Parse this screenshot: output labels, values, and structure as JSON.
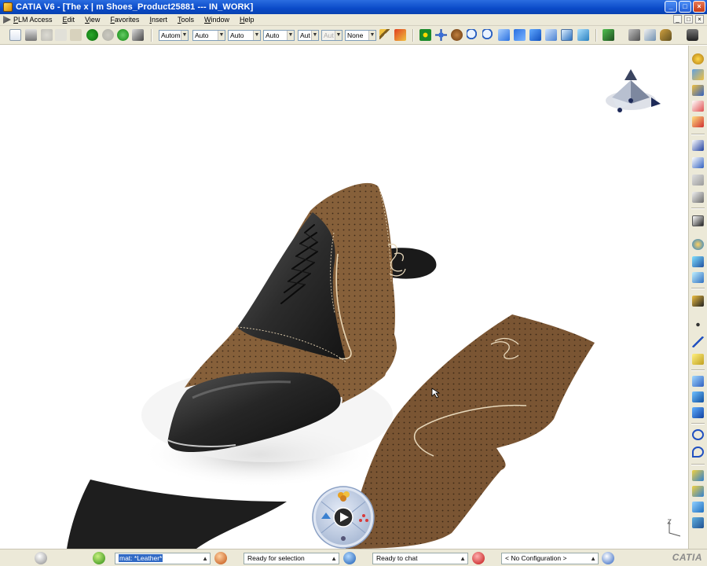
{
  "window": {
    "title": "CATIA V6 - [The x | m Shoes_Product25881 --- IN_WORK]",
    "buttons": {
      "minimize": "_",
      "maximize": "□",
      "close": "×"
    }
  },
  "menubar": {
    "items": [
      "PLM Access",
      "Edit",
      "View",
      "Favorites",
      "Insert",
      "Tools",
      "Window",
      "Help"
    ],
    "controls": [
      "_",
      "□",
      "×"
    ]
  },
  "toolbar": {
    "combos": [
      {
        "value": "Automa",
        "enabled": true
      },
      {
        "value": "Auto",
        "enabled": true
      },
      {
        "value": "Auto",
        "enabled": true
      },
      {
        "value": "Auto",
        "enabled": true
      },
      {
        "value": "Aut",
        "enabled": true
      },
      {
        "value": "Aut",
        "enabled": false
      },
      {
        "value": "None",
        "enabled": true
      }
    ],
    "icons": [
      "new-icon",
      "print-icon",
      "cut-icon",
      "copy-icon",
      "paste-icon",
      "undo-icon",
      "redo-icon",
      "refresh-icon",
      "whats-this-icon",
      "paint-brush-icon",
      "painter-icon",
      "fit-all-icon",
      "pan-icon",
      "rotate-icon",
      "zoom-in-icon",
      "zoom-out-icon",
      "normal-view-icon",
      "iso-view-icon",
      "shading-icon",
      "hide-show-icon",
      "swap-visible-icon",
      "tools-icon",
      "measure-icon",
      "hand-icon",
      "camera-icon"
    ]
  },
  "right_toolbar": {
    "icons": [
      "fur-icon",
      "paint-icon",
      "sew-icon",
      "pattern-icon",
      "stitch-icon",
      "axis-icon",
      "dimension-icon",
      "cone-icon",
      "sketch-icon",
      "surface-icon",
      "edge-icon",
      "flatten-icon",
      "sweep-icon",
      "point-icon",
      "line-icon",
      "plane-icon",
      "blend-icon",
      "fill-icon",
      "offset-icon",
      "circle-icon",
      "spiral-icon",
      "extrude-icon",
      "revolve-icon",
      "shell-icon",
      "mirror-icon"
    ]
  },
  "compass": {
    "name": "3d-compass"
  },
  "robot": {
    "name": "navigation-robot"
  },
  "statusbar": {
    "command_input": "mat: *Leather*",
    "status_text": "Ready for selection",
    "chat_text": "Ready to chat",
    "configuration": "< No Configuration >",
    "brand": "CATIA"
  },
  "colors": {
    "title_bar": "#0a4ac8",
    "chrome": "#ece9d8",
    "leather_brown": "#86603a",
    "leather_black": "#2a2a2a",
    "selection_blue": "#316ac5"
  }
}
